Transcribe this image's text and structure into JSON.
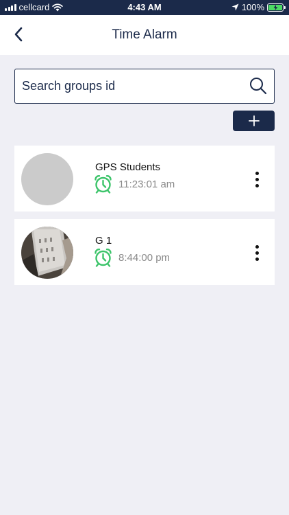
{
  "status_bar": {
    "carrier": "cellcard",
    "time": "4:43 AM",
    "battery": "100%"
  },
  "nav": {
    "title": "Time Alarm",
    "back_icon": "chevron-left-icon"
  },
  "search": {
    "placeholder": "Search groups id",
    "icon": "search-icon"
  },
  "add_button": {
    "icon": "plus-icon"
  },
  "groups": [
    {
      "name": "GPS Students",
      "alarm_time": "11:23:01 am",
      "avatar": "blank"
    },
    {
      "name": "G 1",
      "alarm_time": "8:44:00 pm",
      "avatar": "photo"
    }
  ],
  "colors": {
    "primary": "#1b2a4a",
    "alarm_green": "#3cc46a",
    "background": "#efeff5"
  }
}
